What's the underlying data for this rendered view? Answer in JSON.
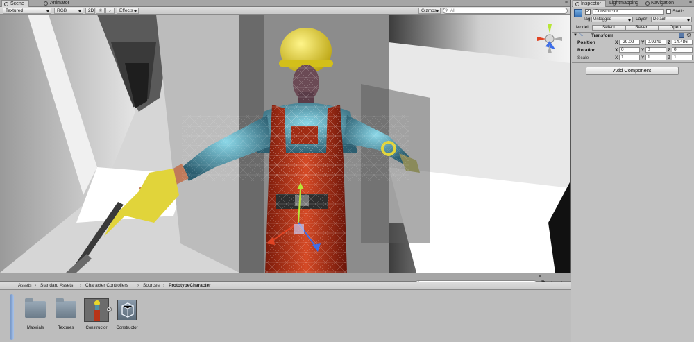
{
  "scene_tabs": [
    {
      "label": "Scene",
      "active": true
    },
    {
      "label": "Animator",
      "active": false
    }
  ],
  "scene_toolbar": {
    "shading_mode": "Textured",
    "render_mode": "RGB",
    "mode_2d": "2D",
    "effects": "Effects",
    "gizmos": "Gizmos",
    "search_placeholder": "All"
  },
  "inspector_tabs": [
    {
      "label": "Inspector",
      "active": true
    },
    {
      "label": "Lightmapping",
      "active": false
    },
    {
      "label": "Navigation",
      "active": false
    }
  ],
  "game_object": {
    "name": "Constructor",
    "active_checked": true,
    "static_label": "Static",
    "static_checked": false,
    "tag_label": "Tag",
    "tag_value": "Untagged",
    "layer_label": "Layer",
    "layer_value": "Default",
    "model_label": "Model",
    "select_label": "Select",
    "revert_label": "Revert",
    "open_label": "Open"
  },
  "transform": {
    "title": "Transform",
    "position_label": "Position",
    "rotation_label": "Rotation",
    "scale_label": "Scale",
    "axis_x": "X",
    "axis_y": "Y",
    "axis_z": "Z",
    "position": {
      "x": "-29.09",
      "y": "0.9249",
      "z": "14.486"
    },
    "rotation": {
      "x": "0",
      "y": "0",
      "z": "0"
    },
    "scale": {
      "x": "1",
      "y": "1",
      "z": "1"
    }
  },
  "add_component_label": "Add Component",
  "project": {
    "breadcrumb": [
      "Assets",
      "Standard Assets",
      "Character Controllers",
      "Sources",
      "PrototypeCharacter"
    ],
    "breadcrumb_sep": "›",
    "assets": [
      {
        "label": "Materials",
        "kind": "folder"
      },
      {
        "label": "Textures",
        "kind": "folder"
      },
      {
        "label": "Constructor",
        "kind": "model"
      },
      {
        "label": "Constructor",
        "kind": "prefab"
      }
    ]
  },
  "colors": {
    "hard_hat": "#e8d62a",
    "shirt": "#4f8fa4",
    "overalls": "#b83418",
    "gloves": "#e1d43a",
    "gizmo_y": "#b8e636",
    "gizmo_x": "#e04424",
    "gizmo_z": "#3e6ee8"
  }
}
